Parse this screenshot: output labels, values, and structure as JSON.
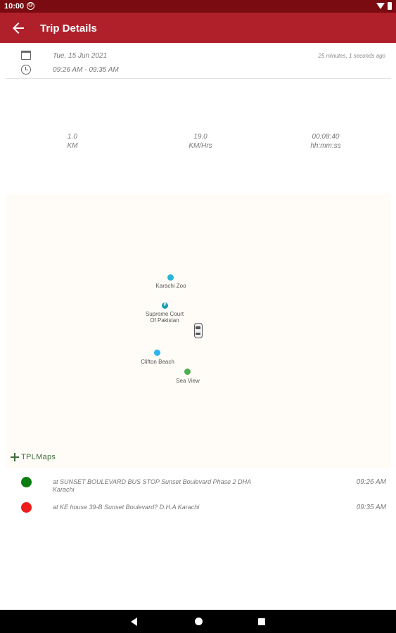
{
  "status_bar": {
    "time": "10:00",
    "app_icon_glyph": "@"
  },
  "app_bar": {
    "title": "Trip Details",
    "back_icon": "arrow-back-icon"
  },
  "trip": {
    "date": "Tue, 15 Jun 2021",
    "time_range": "09:26 AM - 09:35 AM",
    "ago": "25 minutes, 1 seconds ago"
  },
  "stats": [
    {
      "value": "1.0",
      "unit": "KM"
    },
    {
      "value": "19.0",
      "unit": "KM/Hrs"
    },
    {
      "value": "00:08:40",
      "unit": "hh:mm:ss"
    }
  ],
  "map": {
    "pois": [
      {
        "label": "Karachi Zoo",
        "color": "#29b6d6",
        "glyph": ""
      },
      {
        "label": "Supreme Court\nOf Pakistan",
        "color": "#1a9cb0",
        "glyph": "P"
      },
      {
        "label": "Clifton Beach",
        "color": "#29b6f0",
        "glyph": ""
      },
      {
        "label": "Sea View",
        "color": "#4caf50",
        "glyph": ""
      }
    ],
    "logo_text": "TPLMaps"
  },
  "stops": [
    {
      "address": "at SUNSET BOULEVARD BUS STOP Sunset Boulevard Phase 2 DHA Karachi",
      "time": "09:26 AM",
      "color": "#0a7d12"
    },
    {
      "address": "at KE house 39-B Sunset Boulevard? D.H.A Karachi",
      "time": "09:35 AM",
      "color": "#ee1c1c"
    }
  ]
}
